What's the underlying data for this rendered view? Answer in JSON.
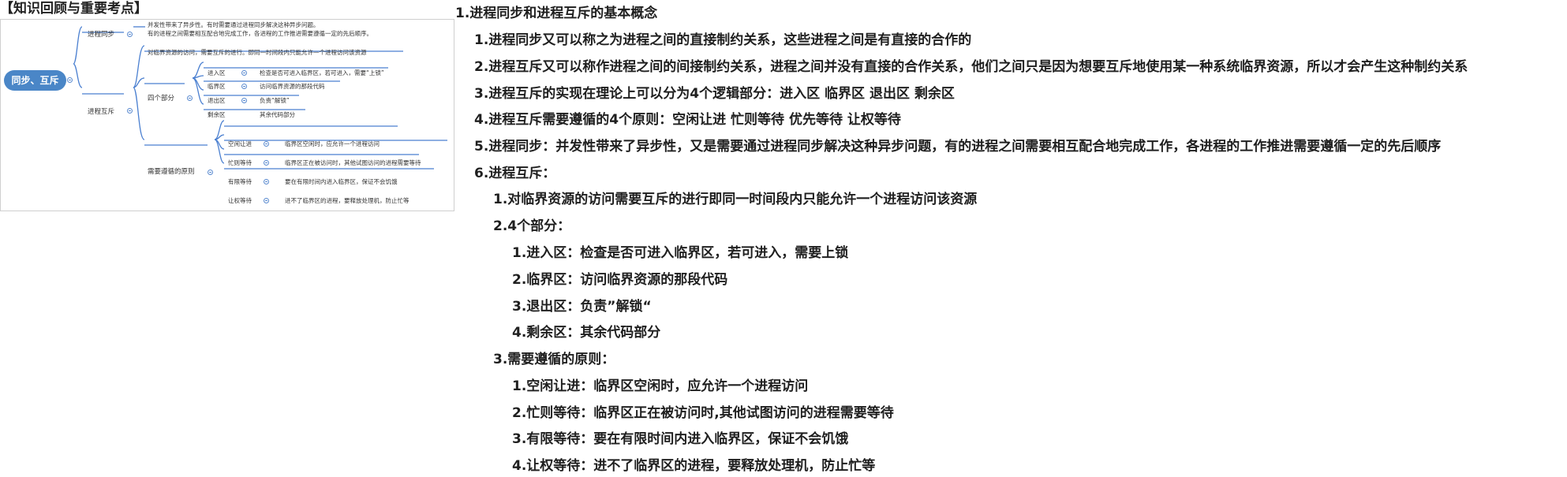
{
  "header": {
    "title": "【知识回顾与重要考点】"
  },
  "mindmap": {
    "root": "同步、互斥",
    "sync": {
      "label": "进程同步",
      "desc_line1": "并发性带来了异步性。有时需要通过进程同步解决这种异步问题。",
      "desc_line2": "有的进程之间需要相互配合地完成工作，各进程的工作推进需要遵循一定的先后顺序。"
    },
    "mutex": {
      "label": "进程互斥",
      "desc": "对临界资源的访问，需要互斥的进行。即同一时间段内只能允许一个进程访问该资源",
      "parts": {
        "label": "四个部分",
        "items": [
          {
            "label": "进入区",
            "desc": "检查是否可进入临界区，若可进入，需要“上锁”"
          },
          {
            "label": "临界区",
            "desc": "访问临界资源的那段代码"
          },
          {
            "label": "退出区",
            "desc": "负责“解锁”"
          },
          {
            "label": "剩余区",
            "desc": "其余代码部分"
          }
        ]
      },
      "principles": {
        "label": "需要遵循的原则",
        "items": [
          {
            "label": "空闲让进",
            "desc": "临界区空闲时，应允许一个进程访问"
          },
          {
            "label": "忙则等待",
            "desc": "临界区正在被访问时，其他试图访问的进程需要等待"
          },
          {
            "label": "有限等待",
            "desc": "要在有限时间内进入临界区，保证不会饥饿"
          },
          {
            "label": "让权等待",
            "desc": "进不了临界区的进程，要释放处理机，防止忙等"
          }
        ]
      }
    }
  },
  "outline": {
    "lines": [
      "1.进程同步和进程互斥的基本概念",
      "1.进程同步又可以称之为进程之间的直接制约关系，这些进程之间是有直接的合作的",
      "2.进程互斥又可以称作进程之间的间接制约关系，进程之间并没有直接的合作关系，他们之间只是因为想要互斥地使用某一种系统临界资源，所以才会产生这种制约关系",
      "3.进程互斥的实现在理论上可以分为4个逻辑部分：进入区 临界区 退出区 剩余区",
      "4.进程互斥需要遵循的4个原则：空闲让进 忙则等待 优先等待 让权等待",
      "5.进程同步：并发性带来了异步性，又是需要通过进程同步解决这种异步问题，有的进程之间需要相互配合地完成工作，各进程的工作推进需要遵循一定的先后顺序",
      "6.进程互斥：",
      "1.对临界资源的访问需要互斥的进行即同一时间段内只能允许一个进程访问该资源",
      "2.4个部分：",
      "1.进入区：检查是否可进入临界区，若可进入，需要上锁",
      "2.临界区：访问临界资源的那段代码",
      "3.退出区：负责”解锁“",
      "4.剩余区：其余代码部分",
      "3.需要遵循的原则：",
      "1.空闲让进：临界区空闲时，应允许一个进程访问",
      "2.忙则等待：临界区正在被访问时,其他试图访问的进程需要等待",
      "3.有限等待：要在有限时间内进入临界区，保证不会饥饿",
      "4.让权等待：进不了临界区的进程，要释放处理机，防止忙等"
    ]
  }
}
